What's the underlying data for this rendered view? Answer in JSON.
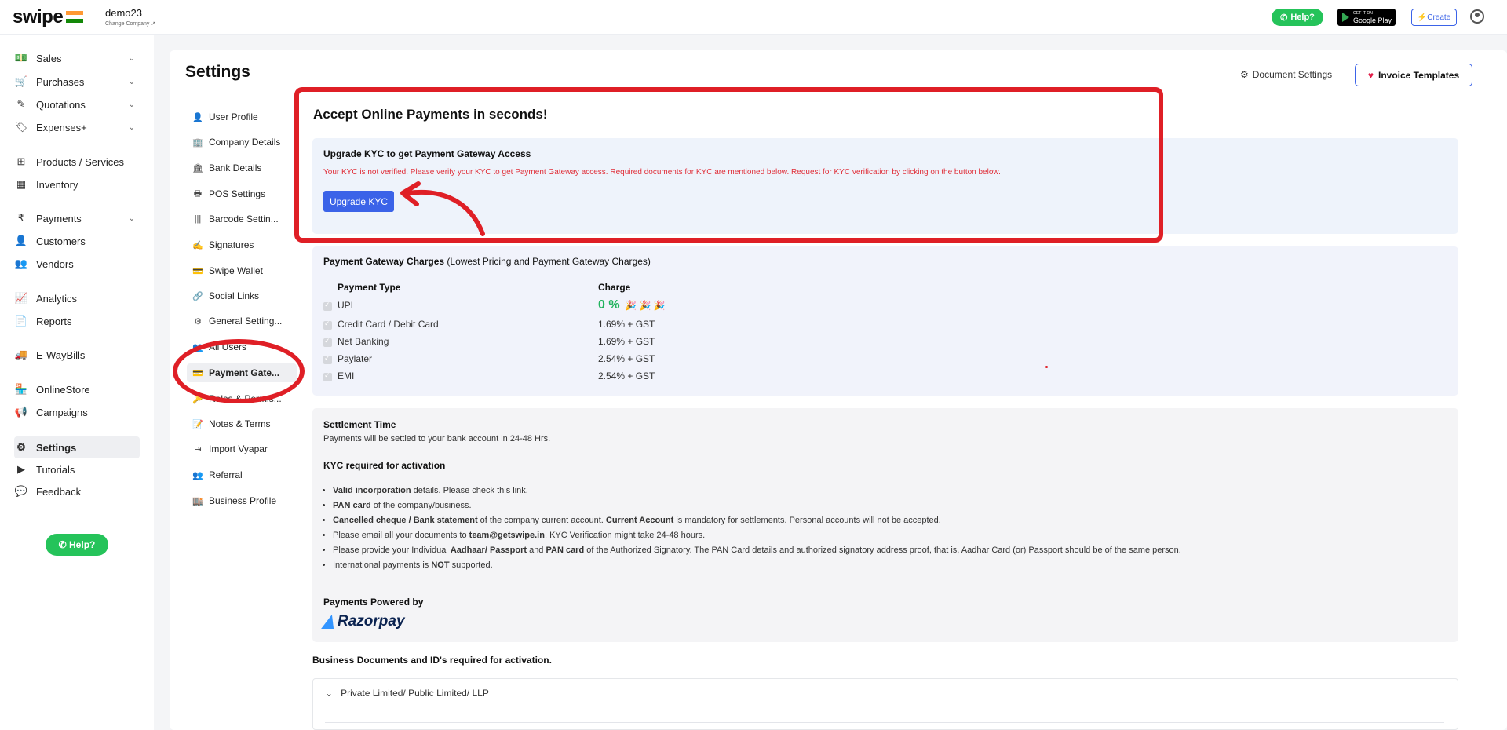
{
  "topbar": {
    "logo": "swipe",
    "company_name": "demo23",
    "change_company": "Change Company ↗",
    "help": "Help?",
    "gplay_small": "GET IT ON",
    "gplay_big": "Google Play",
    "create": "⚡Create"
  },
  "sidebar": {
    "items": [
      {
        "label": "Sales",
        "icon": "💵",
        "chevron": "⌄"
      },
      {
        "label": "Purchases",
        "icon": "🛒",
        "chevron": "⌄"
      },
      {
        "label": "Quotations",
        "icon": "✎",
        "chevron": "⌄"
      },
      {
        "label": "Expenses+",
        "icon": "🏷",
        "chevron": "⌄"
      },
      {
        "label": "Products / Services",
        "icon": "⊞"
      },
      {
        "label": "Inventory",
        "icon": "▦"
      },
      {
        "label": "Payments",
        "icon": "₹",
        "chevron": "⌄"
      },
      {
        "label": "Customers",
        "icon": "👤"
      },
      {
        "label": "Vendors",
        "icon": "👥"
      },
      {
        "label": "Analytics",
        "icon": "📈"
      },
      {
        "label": "Reports",
        "icon": "📄"
      },
      {
        "label": "E-WayBills",
        "icon": "🚚"
      },
      {
        "label": "OnlineStore",
        "icon": "🏪"
      },
      {
        "label": "Campaigns",
        "icon": "📢"
      },
      {
        "label": "Settings",
        "icon": "⚙"
      },
      {
        "label": "Tutorials",
        "icon": "▶"
      },
      {
        "label": "Feedback",
        "icon": "💬"
      }
    ],
    "help": "Help?"
  },
  "page": {
    "title": "Settings",
    "doc_settings": "Document Settings",
    "invoice_templates": "Invoice Templates"
  },
  "submenu": [
    {
      "label": "User Profile",
      "icon": "👤"
    },
    {
      "label": "Company Details",
      "icon": "🏢"
    },
    {
      "label": "Bank Details",
      "icon": "🏛"
    },
    {
      "label": "POS Settings",
      "icon": "🖶"
    },
    {
      "label": "Barcode Settin...",
      "icon": "|||"
    },
    {
      "label": "Signatures",
      "icon": "✍"
    },
    {
      "label": "Swipe Wallet",
      "icon": "💳"
    },
    {
      "label": "Social Links",
      "icon": "🔗"
    },
    {
      "label": "General Setting...",
      "icon": "⚙"
    },
    {
      "label": "All Users",
      "icon": "👥"
    },
    {
      "label": "Payment Gate...",
      "icon": "💳"
    },
    {
      "label": "Roles & Permis...",
      "icon": "🔑"
    },
    {
      "label": "Notes & Terms",
      "icon": "📝"
    },
    {
      "label": "Import Vyapar",
      "icon": "⇥"
    },
    {
      "label": "Referral",
      "icon": "👥"
    },
    {
      "label": "Business Profile",
      "icon": "🏬"
    }
  ],
  "kyc": {
    "title": "Accept Online Payments in seconds!",
    "heading": "Upgrade KYC to get Payment Gateway Access",
    "warning": "Your KYC is not verified. Please verify your KYC to get Payment Gateway access. Required documents for KYC are mentioned below. Request for KYC verification by clicking on the button below.",
    "button": "Upgrade KYC"
  },
  "gateway": {
    "title_bold": "Payment Gateway Charges",
    "title_rest": " (Lowest Pricing and Payment Gateway Charges)",
    "col_type": "Payment Type",
    "col_charge": "Charge",
    "rows": [
      {
        "type": "UPI",
        "charge": "0 %"
      },
      {
        "type": "Credit Card / Debit Card",
        "charge": "1.69% + GST"
      },
      {
        "type": "Net Banking",
        "charge": "1.69% + GST"
      },
      {
        "type": "Paylater",
        "charge": "2.54% + GST"
      },
      {
        "type": "EMI",
        "charge": "2.54% + GST"
      }
    ],
    "party": "🎉 🎉 🎉"
  },
  "settlement": {
    "title": "Settlement Time",
    "text": "Payments will be settled to your bank account in 24-48 Hrs.",
    "kyc_title": "KYC required for activation",
    "bullets": [
      {
        "b": "Valid incorporation",
        "t": " details. Please check this link."
      },
      {
        "b": "PAN card",
        "t": " of the company/business."
      },
      {
        "b": "Cancelled cheque / Bank statement",
        "t": " of the company current account. ",
        "b2": "Current Account",
        "t2": " is mandatory for settlements. Personal accounts will not be accepted."
      },
      {
        "pre": "Please email all your documents to ",
        "b": "team@getswipe.in",
        "t": ". KYC Verification might take 24-48 hours."
      },
      {
        "pre": "Please provide your Individual ",
        "b": "Aadhaar/ Passport",
        "t": " and ",
        "b2": "PAN card",
        "t2": " of the Authorized Signatory. The PAN Card details and authorized signatory address proof, that is, Aadhar Card (or) Passport should be of the same person."
      },
      {
        "pre": "International payments is ",
        "b": "NOT",
        "t": " supported."
      }
    ],
    "powered_by": "Payments Powered by",
    "razorpay": "Razorpay"
  },
  "business_docs": {
    "title": "Business Documents and ID's required for activation.",
    "accordion": "Private Limited/ Public Limited/ LLP"
  },
  "colors": {
    "accent": "#3b63e8",
    "annotation_red": "#df1f26",
    "green": "#25c35a"
  }
}
